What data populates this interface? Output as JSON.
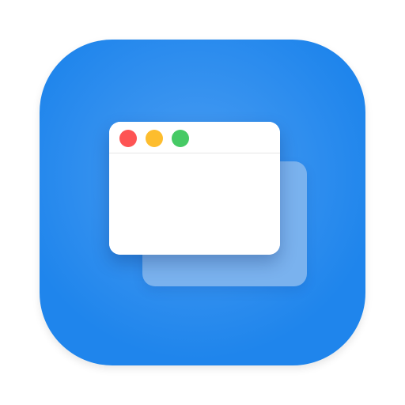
{
  "app_icon": {
    "icon_name": "window-switcher-app-icon",
    "colors": {
      "background_center": "#4a9df2",
      "background_edge": "#1f85ec",
      "front_window": "#ffffff",
      "back_window": "#7ab2ee",
      "titlebar_divider": "#e6e6e6"
    },
    "traffic_lights": [
      {
        "name": "close",
        "color": "#fe5454"
      },
      {
        "name": "minimize",
        "color": "#fdbd2e"
      },
      {
        "name": "zoom",
        "color": "#46ca65"
      }
    ]
  }
}
